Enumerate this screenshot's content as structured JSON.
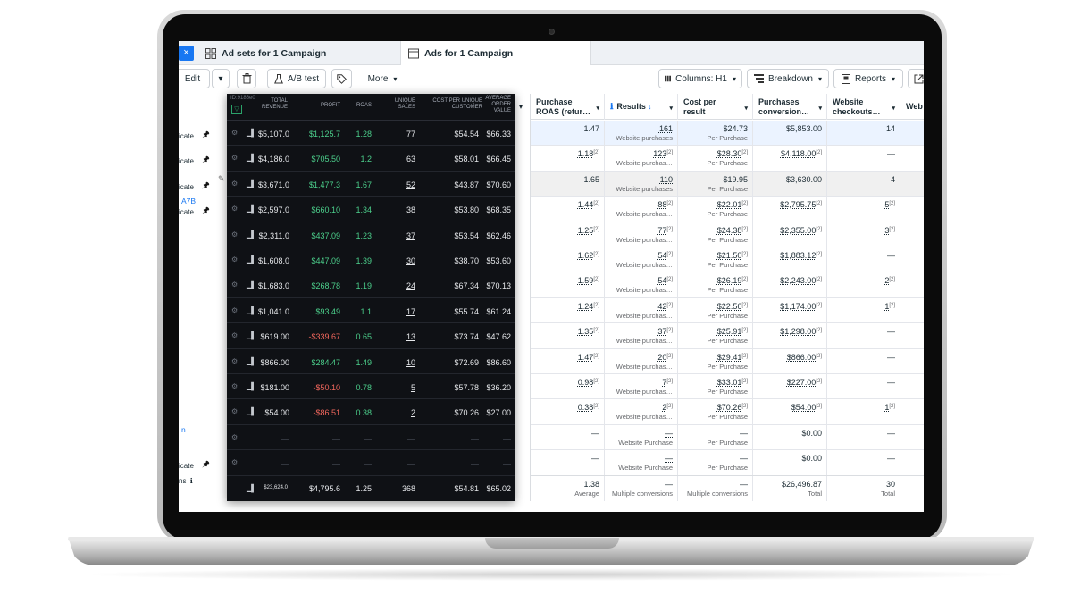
{
  "tabs": {
    "close_glyph": "×",
    "ad_sets": "Ad sets for 1 Campaign",
    "ads": "Ads for 1 Campaign"
  },
  "toolbar": {
    "edit": "Edit",
    "ab_test": "A/B test",
    "more": "More",
    "columns": "Columns: H1",
    "breakdown": "Breakdown",
    "reports": "Reports"
  },
  "dark_header": {
    "id_label": "ID:9186e0",
    "total_revenue": "TOTAL REVENUE",
    "profit": "PROFIT",
    "roas": "ROAS",
    "unique_sales": "UNIQUE SALES",
    "cost_per_unique": "COST PER UNIQUE CUSTOMER",
    "aov": "AVERAGE ORDER VALUE"
  },
  "columns": {
    "purchase_roas": "Purchase ROAS (retur…",
    "results": "Results",
    "cost_per_result": "Cost per result",
    "purchases_conversion": "Purchases conversion…",
    "website_checkouts": "Website checkouts…",
    "web": "Web"
  },
  "name_rows": [
    {
      "line1": "",
      "line2": "icate",
      "pin": true
    },
    {
      "line1": "",
      "line2": "icate",
      "pin": true
    },
    {
      "line1": "",
      "line2": "icate",
      "pin": true
    },
    {
      "line1": "A7B",
      "line2": "icate",
      "pin": true
    },
    {
      "line1": "",
      "line2": "",
      "pin": false
    },
    {
      "line1": "",
      "line2": "",
      "pin": false
    },
    {
      "line1": "",
      "line2": "",
      "pin": false
    },
    {
      "line1": "",
      "line2": "",
      "pin": false
    },
    {
      "line1": "",
      "line2": "",
      "pin": false
    },
    {
      "line1": "",
      "line2": "",
      "pin": false
    },
    {
      "line1": "",
      "line2": "",
      "pin": false
    },
    {
      "line1": "",
      "line2": "",
      "pin": false
    },
    {
      "line1": "n",
      "line2": "",
      "pin": false
    },
    {
      "line1": "",
      "line2": "icate",
      "pin": true
    }
  ],
  "dark_rows": [
    {
      "revenue": "$5,107.0",
      "profit": "$1,125.7",
      "profit_neg": false,
      "roas": "1.28",
      "sales": "77",
      "cpu": "$54.54",
      "aov": "$66.33"
    },
    {
      "revenue": "$4,186.0",
      "profit": "$705.50",
      "profit_neg": false,
      "roas": "1.2",
      "sales": "63",
      "cpu": "$58.01",
      "aov": "$66.45"
    },
    {
      "revenue": "$3,671.0",
      "profit": "$1,477.3",
      "profit_neg": false,
      "roas": "1.67",
      "sales": "52",
      "cpu": "$43.87",
      "aov": "$70.60"
    },
    {
      "revenue": "$2,597.0",
      "profit": "$660.10",
      "profit_neg": false,
      "roas": "1.34",
      "sales": "38",
      "cpu": "$53.80",
      "aov": "$68.35"
    },
    {
      "revenue": "$2,311.0",
      "profit": "$437.09",
      "profit_neg": false,
      "roas": "1.23",
      "sales": "37",
      "cpu": "$53.54",
      "aov": "$62.46"
    },
    {
      "revenue": "$1,608.0",
      "profit": "$447.09",
      "profit_neg": false,
      "roas": "1.39",
      "sales": "30",
      "cpu": "$38.70",
      "aov": "$53.60"
    },
    {
      "revenue": "$1,683.0",
      "profit": "$268.78",
      "profit_neg": false,
      "roas": "1.19",
      "sales": "24",
      "cpu": "$67.34",
      "aov": "$70.13"
    },
    {
      "revenue": "$1,041.0",
      "profit": "$93.49",
      "profit_neg": false,
      "roas": "1.1",
      "sales": "17",
      "cpu": "$55.74",
      "aov": "$61.24"
    },
    {
      "revenue": "$619.00",
      "profit": "-$339.67",
      "profit_neg": true,
      "roas": "0.65",
      "sales": "13",
      "cpu": "$73.74",
      "aov": "$47.62"
    },
    {
      "revenue": "$866.00",
      "profit": "$284.47",
      "profit_neg": false,
      "roas": "1.49",
      "sales": "10",
      "cpu": "$72.69",
      "aov": "$86.60"
    },
    {
      "revenue": "$181.00",
      "profit": "-$50.10",
      "profit_neg": true,
      "roas": "0.78",
      "sales": "5",
      "cpu": "$57.78",
      "aov": "$36.20"
    },
    {
      "revenue": "$54.00",
      "profit": "-$86.51",
      "profit_neg": true,
      "roas": "0.38",
      "sales": "2",
      "cpu": "$70.26",
      "aov": "$27.00"
    },
    {
      "revenue": "—",
      "profit": "—",
      "profit_neg": false,
      "roas": "—",
      "sales": "—",
      "cpu": "—",
      "aov": "—",
      "empty": true
    },
    {
      "revenue": "—",
      "profit": "—",
      "profit_neg": false,
      "roas": "—",
      "sales": "—",
      "cpu": "—",
      "aov": "—",
      "empty": true
    }
  ],
  "dark_total": {
    "revenue": "$23,624.0",
    "profit": "$4,795.6",
    "roas": "1.25",
    "sales": "368",
    "cpu": "$54.81",
    "aov": "$65.02"
  },
  "right_rows": [
    {
      "roas": "1.47",
      "roas_sup": false,
      "results": "161",
      "results_sub": "Website purchases",
      "cpr": "$24.73",
      "cpr_sub": "Per Purchase",
      "pc": "$5,853.00",
      "wc": "14",
      "flag": "hl"
    },
    {
      "roas": "1.18",
      "roas_sup": true,
      "results": "123",
      "results_sub": "Website purchas…",
      "cpr": "$28.30",
      "cpr_sub": "Per Purchase",
      "pc": "$4,118.00",
      "wc": "—",
      "flag": ""
    },
    {
      "roas": "1.65",
      "roas_sup": false,
      "results": "110",
      "results_sub": "Website purchases",
      "cpr": "$19.95",
      "cpr_sub": "Per Purchase",
      "pc": "$3,630.00",
      "wc": "4",
      "flag": "gray"
    },
    {
      "roas": "1.44",
      "roas_sup": true,
      "results": "88",
      "results_sub": "Website purchas…",
      "cpr": "$22.01",
      "cpr_sub": "Per Purchase",
      "pc": "$2,795.75",
      "wc": "5",
      "flag": ""
    },
    {
      "roas": "1.25",
      "roas_sup": true,
      "results": "77",
      "results_sub": "Website purchas…",
      "cpr": "$24.38",
      "cpr_sub": "Per Purchase",
      "pc": "$2,355.00",
      "wc": "3",
      "flag": ""
    },
    {
      "roas": "1.62",
      "roas_sup": true,
      "results": "54",
      "results_sub": "Website purchas…",
      "cpr": "$21.50",
      "cpr_sub": "Per Purchase",
      "pc": "$1,883.12",
      "wc": "—",
      "flag": ""
    },
    {
      "roas": "1.59",
      "roas_sup": true,
      "results": "54",
      "results_sub": "Website purchas…",
      "cpr": "$26.19",
      "cpr_sub": "Per Purchase",
      "pc": "$2,243.00",
      "wc": "2",
      "flag": ""
    },
    {
      "roas": "1.24",
      "roas_sup": true,
      "results": "42",
      "results_sub": "Website purchas…",
      "cpr": "$22.56",
      "cpr_sub": "Per Purchase",
      "pc": "$1,174.00",
      "wc": "1",
      "flag": ""
    },
    {
      "roas": "1.35",
      "roas_sup": true,
      "results": "37",
      "results_sub": "Website purchas…",
      "cpr": "$25.91",
      "cpr_sub": "Per Purchase",
      "pc": "$1,298.00",
      "wc": "—",
      "flag": ""
    },
    {
      "roas": "1.47",
      "roas_sup": true,
      "results": "20",
      "results_sub": "Website purchas…",
      "cpr": "$29.41",
      "cpr_sub": "Per Purchase",
      "pc": "$866.00",
      "wc": "—",
      "flag": ""
    },
    {
      "roas": "0.98",
      "roas_sup": true,
      "results": "7",
      "results_sub": "Website purchas…",
      "cpr": "$33.01",
      "cpr_sub": "Per Purchase",
      "pc": "$227.00",
      "wc": "—",
      "flag": ""
    },
    {
      "roas": "0.38",
      "roas_sup": true,
      "results": "2",
      "results_sub": "Website purchas…",
      "cpr": "$70.26",
      "cpr_sub": "Per Purchase",
      "pc": "$54.00",
      "wc": "1",
      "flag": ""
    },
    {
      "roas": "—",
      "roas_sup": false,
      "results": "—",
      "results_sub": "Website Purchase",
      "cpr": "—",
      "cpr_sub": "Per Purchase",
      "pc": "$0.00",
      "wc": "—",
      "flag": ""
    },
    {
      "roas": "—",
      "roas_sup": false,
      "results": "—",
      "results_sub": "Website Purchase",
      "cpr": "—",
      "cpr_sub": "Per Purchase",
      "pc": "$0.00",
      "wc": "—",
      "flag": ""
    }
  ],
  "right_total": {
    "roas": "1.38",
    "roas_sub": "Average",
    "results": "—",
    "results_sub": "Multiple conversions",
    "cpr": "—",
    "cpr_sub": "Multiple conversions",
    "pc": "$26,496.87",
    "pc_sub": "Total",
    "wc": "30",
    "wc_sub": "Total"
  },
  "total_label": "ns",
  "sup_mark": "[2]",
  "icons": {
    "pin": "📌",
    "info": "ℹ",
    "sort_down": "↓",
    "caret": "▾",
    "gear": "⚙",
    "filter": "▽",
    "spark": "▁▌",
    "pencil": "✎"
  }
}
